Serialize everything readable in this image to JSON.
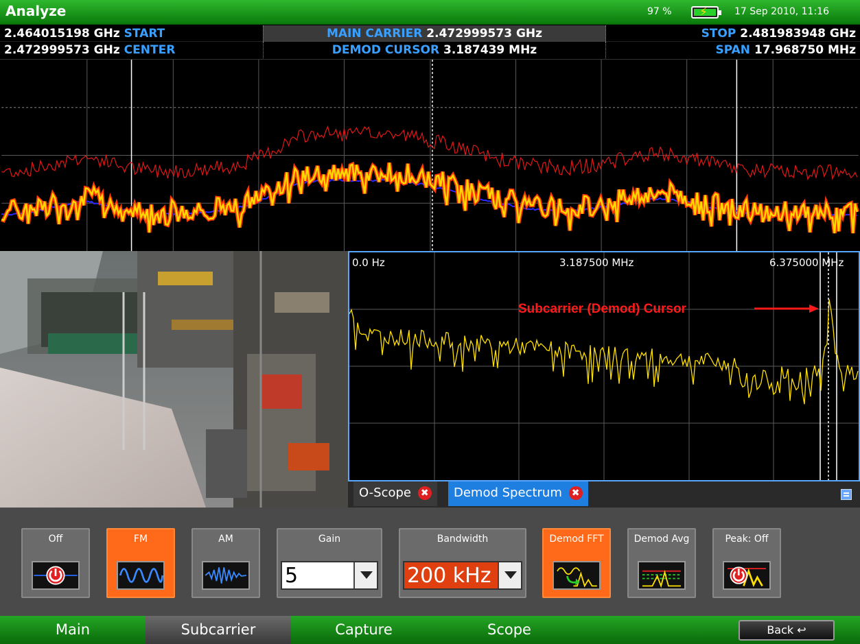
{
  "app": {
    "title": "Analyze",
    "battery_percent": "97 %",
    "datetime": "17 Sep 2010, 11:16"
  },
  "info": {
    "start_value": "2.464015198 GHz",
    "start_label": "START",
    "main_carrier_label": "MAIN CARRIER",
    "main_carrier_value": "2.472999573 GHz",
    "stop_label": "STOP",
    "stop_value": "2.481983948 GHz",
    "center_value": "2.472999573 GHz",
    "center_label": "CENTER",
    "demod_cursor_label": "DEMOD CURSOR",
    "demod_cursor_value": "3.187439 MHz",
    "span_label": "SPAN",
    "span_value": "17.968750 MHz"
  },
  "demod_spectrum": {
    "axis_left": "0.0 Hz",
    "axis_mid": "3.187500 MHz",
    "axis_right": "6.375000 MHz",
    "annotation": "Subcarrier (Demod) Cursor"
  },
  "demod_tabs": [
    {
      "label": "O-Scope"
    },
    {
      "label": "Demod Spectrum"
    }
  ],
  "controls": {
    "off_label": "Off",
    "fm_label": "FM",
    "am_label": "AM",
    "gain_label": "Gain",
    "gain_value": "5",
    "bandwidth_label": "Bandwidth",
    "bandwidth_value": "200 kHz",
    "demod_fft_label": "Demod FFT",
    "demod_avg_label": "Demod Avg",
    "peak_label": "Peak: Off"
  },
  "nav": {
    "main": "Main",
    "subcarrier": "Subcarrier",
    "capture": "Capture",
    "scope": "Scope",
    "back": "Back ↩"
  },
  "colors": {
    "accent_orange": "#ff6a1a",
    "title_green": "#1a9a1a",
    "info_blue": "#3aa0ff",
    "trace_red": "#e01818",
    "trace_blue": "#2a2aff",
    "trace_yellow": "#ffe000"
  }
}
